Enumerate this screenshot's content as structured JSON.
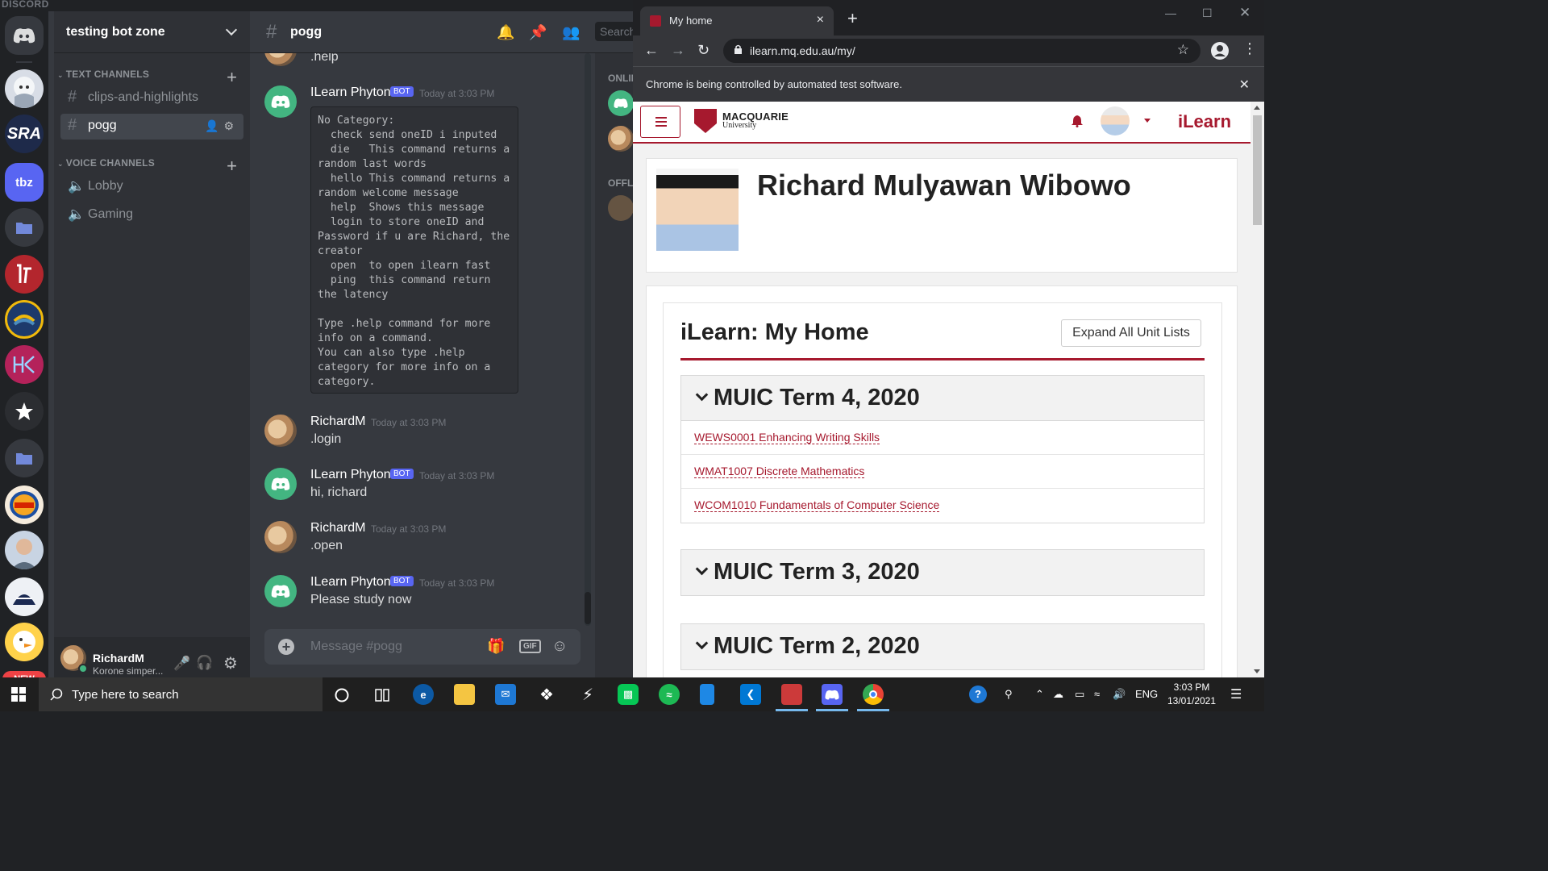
{
  "discord": {
    "brand": "DISCORD",
    "server_name": "testing bot zone",
    "guild_labels": {
      "sra": "SRA",
      "tbz": "tbz",
      "new_badge": "NEW"
    },
    "categories": {
      "text": "TEXT CHANNELS",
      "voice": "VOICE CHANNELS"
    },
    "text_channels": [
      "clips-and-highlights",
      "pogg"
    ],
    "voice_channels": [
      "Lobby",
      "Gaming"
    ],
    "user": {
      "name": "RichardM",
      "status": "Korone simper..."
    },
    "channel_header": {
      "name": "pogg",
      "search_placeholder": "Search"
    },
    "members": {
      "online_label": "ONLIN",
      "offline_label": "OFFLI"
    },
    "messages": [
      {
        "text": ".help"
      },
      {
        "author": "ILearn Phyton",
        "bot": "BOT",
        "time": "Today at 3:03 PM",
        "code": "No Category:\n  check send oneID i inputed\n  die   This command returns a random last words\n  hello This command returns a random welcome message\n  help  Shows this message\n  login to store oneID and Password if u are Richard, the creator\n  open  to open ilearn fast\n  ping  this command return the latency\n\nType .help command for more info on a command.\nYou can also type .help category for more info on a category."
      },
      {
        "author": "RichardM",
        "time": "Today at 3:03 PM",
        "text": ".login"
      },
      {
        "author": "ILearn Phyton",
        "bot": "BOT",
        "time": "Today at 3:03 PM",
        "text": "hi, richard"
      },
      {
        "author": "RichardM",
        "time": "Today at 3:03 PM",
        "text": ".open"
      },
      {
        "author": "ILearn Phyton",
        "bot": "BOT",
        "time": "Today at 3:03 PM",
        "text": "Please study now"
      }
    ],
    "composer_placeholder": "Message #pogg",
    "gif_label": "GIF"
  },
  "chrome": {
    "tab_title": "My home",
    "url": "ilearn.mq.edu.au/my/",
    "infobar": "Chrome is being controlled by automated test software.",
    "page": {
      "org_name": "MACQUARIE",
      "org_sub": "University",
      "brand": "iLearn",
      "profile_name": "Richard Mulyawan Wibowo",
      "home_title": "iLearn: My Home",
      "expand_button": "Expand All Unit Lists",
      "terms": [
        {
          "title": "MUIC Term 4, 2020",
          "units": [
            "WEWS0001 Enhancing Writing Skills",
            "WMAT1007 Discrete Mathematics",
            "WCOM1010 Fundamentals of Computer Science"
          ]
        },
        {
          "title": "MUIC Term 3, 2020"
        },
        {
          "title": "MUIC Term 2, 2020"
        }
      ]
    }
  },
  "taskbar": {
    "search_placeholder": "Type here to search",
    "language": "ENG",
    "time": "3:03 PM",
    "date": "13/01/2021"
  },
  "colors": {
    "discord_bg": "#36393f",
    "discord_sidebar": "#2f3136",
    "discord_rail": "#202225",
    "discord_blurple": "#5865f2",
    "bot_green": "#43b581",
    "mq_red": "#a6192e",
    "chrome_dark": "#202124"
  }
}
